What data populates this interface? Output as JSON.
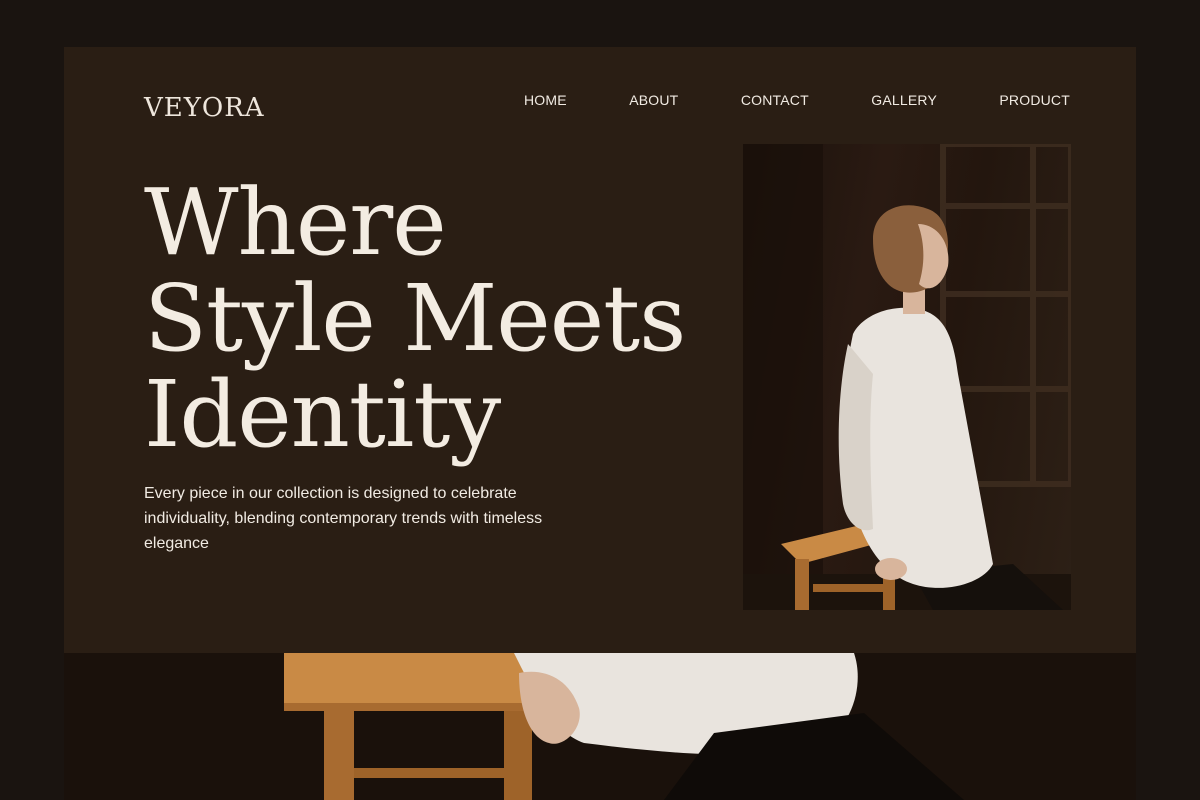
{
  "brand": "VEYORA",
  "nav": {
    "items": [
      {
        "label": "HOME"
      },
      {
        "label": "ABOUT"
      },
      {
        "label": "CONTACT"
      },
      {
        "label": "GALLERY"
      },
      {
        "label": "PRODUCT"
      }
    ]
  },
  "hero": {
    "title_lines": [
      "Where",
      "Style Meets",
      "Identity"
    ],
    "description": "Every piece in our collection is designed to celebrate individuality, blending contemporary trends with timeless elegance"
  },
  "colors": {
    "background": "#1a1410",
    "card": "#2a1e14",
    "text": "#f3ece2",
    "stool": "#c98a45",
    "shirt": "#e9e4de"
  }
}
